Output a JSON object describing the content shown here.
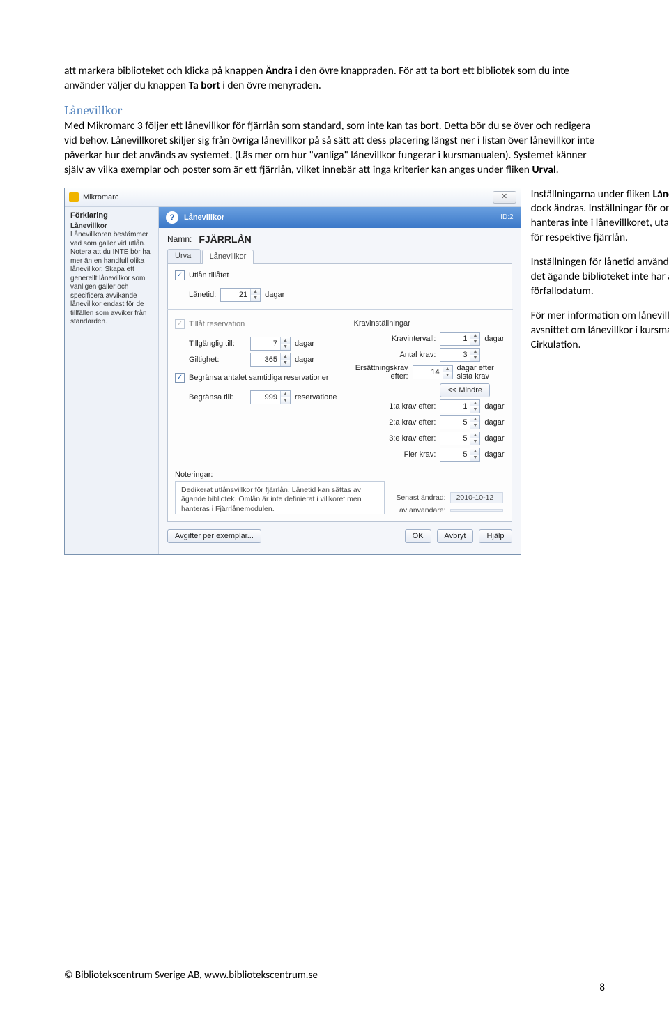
{
  "para1_a": "att markera biblioteket och klicka på knappen ",
  "para1_b": "Ändra",
  "para1_c": " i den övre knappraden. För att ta bort ett bibliotek som du inte använder väljer du knappen ",
  "para1_d": "Ta bort",
  "para1_e": " i den övre menyraden.",
  "heading": "Lånevillkor",
  "para2": "Med Mikromarc 3 följer ett lånevillkor för fjärrlån som standard, som inte kan tas bort. Detta bör du se över och redigera vid behov. Lånevillkoret skiljer sig från övriga lånevillkor på så sätt att dess placering längst ner i listan över lånevillkor inte påverkar hur det används av systemet. (Läs mer om hur \"vanliga\" lånevillkor fungerar i kursmanualen). Systemet känner själv av vilka exemplar och poster som är ett fjärrlån, vilket innebär att inga kriterier kan anges under fliken ",
  "para2_bold": "Urval",
  "para2_end": ".",
  "side1_a": "Inställningarna under fliken ",
  "side1_b": "Lånevillkor",
  "side1_c": " kan dock ändras. Inställningar för omlån hanteras inte i lånevillkoret, utan i ärendet för respektive fjärrlån.",
  "side2": "Inställningen för lånetid används endast om det ägande biblioteket inte har angett något förfallodatum.",
  "side3": "För mer information om lånevillkor, se avsnittet om lånevillkor i kursmanualen för Cirkulation.",
  "win": {
    "title": "Mikromarc",
    "close": "✕",
    "help_title": "Förklaring",
    "help_h": "Lånevillkor",
    "help_txt": "Lånevillkoren bestämmer vad som gäller vid utlån. Notera att du INTE bör ha mer än en handfull olika lånevillkor. Skapa ett generellt lånevillkor som vanligen gäller och specificera avvikande lånevillkor endast för de tillfällen som avviker från standarden.",
    "bar_title": "Lånevillkor",
    "bar_id": "ID:2",
    "name_lbl": "Namn:",
    "name_val": "FJÄRRLÅN",
    "tab1": "Urval",
    "tab2": "Lånevillkor",
    "chk_utlan": "Utlån tillåtet",
    "lanetid_lbl": "Lånetid:",
    "lanetid_val": "21",
    "dagar": "dagar",
    "res_chk": "Tillåt reservation",
    "tillg_lbl": "Tillgänglig till:",
    "tillg_val": "7",
    "gilt_lbl": "Giltighet:",
    "gilt_val": "365",
    "begr_chk": "Begränsa antalet samtidiga reservationer",
    "begr_lbl": "Begränsa till:",
    "begr_val": "999",
    "reservatione": "reservatione",
    "krav_title": "Kravinställningar",
    "kravint_lbl": "Kravintervall:",
    "kravint_val": "1",
    "antal_lbl": "Antal krav:",
    "antal_val": "3",
    "ers_lbl": "Ersättningskrav efter:",
    "ers_val": "14",
    "ers_after": "dagar efter sista krav",
    "less": "<< Mindre",
    "k1_lbl": "1:a krav efter:",
    "k1_val": "1",
    "k2_lbl": "2:a krav efter:",
    "k2_val": "5",
    "k3_lbl": "3:e krav efter:",
    "k3_val": "5",
    "kf_lbl": "Fler krav:",
    "kf_val": "5",
    "not_lbl": "Noteringar:",
    "not_txt": "Dedikerat utlånsvillkor för fjärrlån. Lånetid kan sättas av ägande bibliotek. Omlån är inte definierat i villkoret men hanteras i Fjärrlånemodulen.",
    "senast_lbl": "Senast ändrad:",
    "senast_val": "2010-10-12",
    "av_lbl": "av användare:",
    "av_val": "",
    "avgift": "Avgifter per exemplar...",
    "ok": "OK",
    "avbryt": "Avbryt",
    "hjalp": "Hjälp"
  },
  "footer_text": "© Bibliotekscentrum Sverige AB, www.bibliotekscentrum.se",
  "page_no": "8"
}
